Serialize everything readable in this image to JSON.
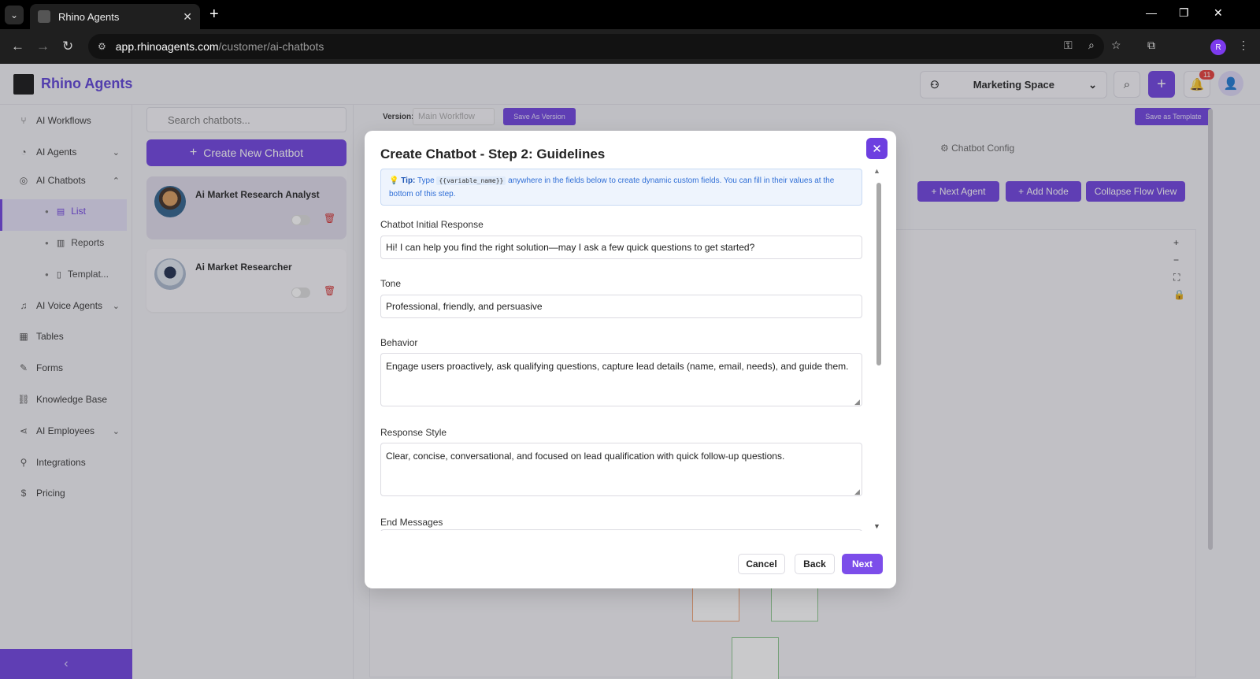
{
  "browser": {
    "tab_title": "Rhino Agents",
    "url_domain": "app.rhinoagents.com",
    "url_path": "/customer/ai-chatbots",
    "profile_initial": "R"
  },
  "header": {
    "brand": "Rhino Agents",
    "workspace": "Marketing Space",
    "notification_count": "11"
  },
  "sidebar": {
    "items": [
      {
        "label": "AI Workflows",
        "icon": "workflow-icon"
      },
      {
        "label": "AI Agents",
        "icon": "agents-icon"
      },
      {
        "label": "AI Chatbots",
        "icon": "chatbot-icon"
      },
      {
        "label": "List",
        "icon": "list-icon"
      },
      {
        "label": "Reports",
        "icon": "chart-icon"
      },
      {
        "label": "Templat...",
        "icon": "template-icon"
      },
      {
        "label": "AI Voice Agents",
        "icon": "mic-icon"
      },
      {
        "label": "Tables",
        "icon": "table-icon"
      },
      {
        "label": "Forms",
        "icon": "form-icon"
      },
      {
        "label": "Knowledge Base",
        "icon": "link-icon"
      },
      {
        "label": "AI Employees",
        "icon": "share-icon"
      },
      {
        "label": "Integrations",
        "icon": "plug-icon"
      },
      {
        "label": "Pricing",
        "icon": "dollar-icon"
      }
    ]
  },
  "chatbots": {
    "search_placeholder": "Search chatbots...",
    "create_label": "Create New Chatbot",
    "items": [
      {
        "name": "Ai Market Research Analyst"
      },
      {
        "name": "Ai Market Researcher"
      }
    ]
  },
  "workflow": {
    "version_label": "Version:",
    "version_value": "Main Workflow",
    "save_version": "Save As Version",
    "save_template": "Save as Template",
    "config_tab": "Chatbot Config",
    "buttons": [
      "Next Agent",
      "Add Node",
      "Collapse Flow View"
    ]
  },
  "modal": {
    "title": "Create Chatbot - Step 2: Guidelines",
    "tip_label": "Tip:",
    "tip_pre": "Type",
    "tip_code": "{{variable_name}}",
    "tip_post": "anywhere in the fields below to create dynamic custom fields. You can fill in their values at the bottom of this step.",
    "fields": {
      "initial_response": {
        "label": "Chatbot Initial Response",
        "value": "Hi! I can help you find the right solution—may I ask a few quick questions to get started?"
      },
      "tone": {
        "label": "Tone",
        "value": "Professional, friendly, and persuasive"
      },
      "behavior": {
        "label": "Behavior",
        "value": "Engage users proactively, ask qualifying questions, capture lead details (name, email, needs), and guide them."
      },
      "response_style": {
        "label": "Response Style",
        "value": "Clear, concise, conversational, and focused on lead qualification with quick follow-up questions."
      },
      "end_messages": {
        "label": "End Messages",
        "value": ""
      }
    },
    "cancel": "Cancel",
    "back": "Back",
    "next": "Next"
  },
  "colors": {
    "accent": "#6d3fe0",
    "danger": "#d32f2f",
    "tip_bg": "#eef4fd"
  }
}
